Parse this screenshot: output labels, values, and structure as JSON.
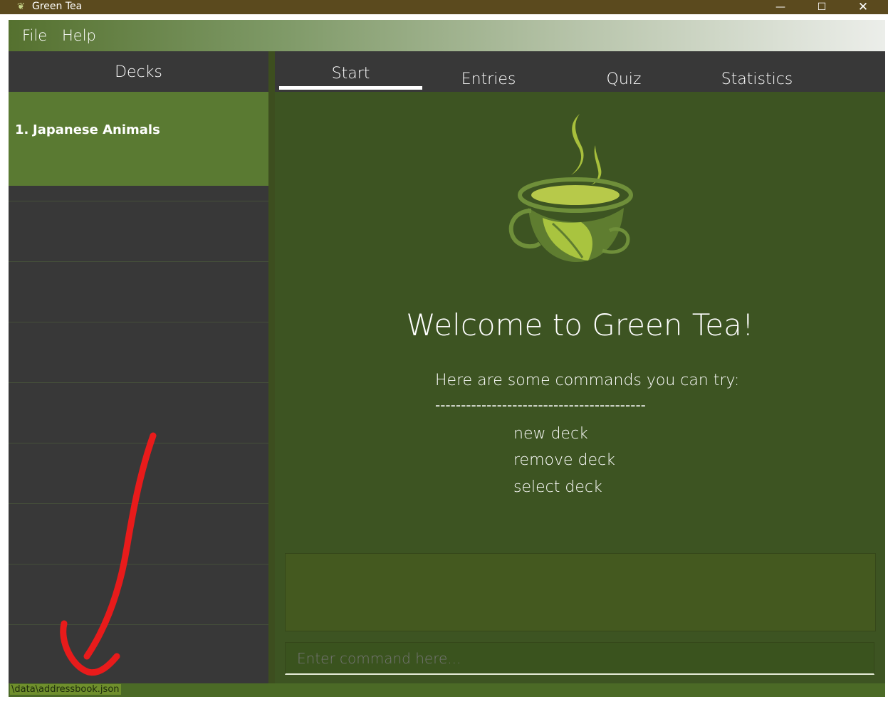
{
  "window": {
    "title": "Green Tea",
    "app_icon": "tea-leaf-icon",
    "controls": {
      "minimize": "—",
      "maximize": "☐",
      "close": "✕"
    }
  },
  "menu": {
    "file": "File",
    "help": "Help"
  },
  "sidebar": {
    "header": "Decks",
    "decks": [
      {
        "index": "1.",
        "name": "Japanese Animals"
      }
    ]
  },
  "tabs": [
    {
      "label": "Start",
      "active": true
    },
    {
      "label": "Entries",
      "active": false
    },
    {
      "label": "Quiz",
      "active": false
    },
    {
      "label": "Statistics",
      "active": false
    }
  ],
  "welcome": {
    "title": "Welcome to Green Tea!",
    "hint": "Here are some commands you can try:",
    "divider": "-----------------------------------------",
    "commands": [
      "new deck",
      "remove deck",
      "select deck"
    ]
  },
  "command_input": {
    "placeholder": "Enter command here..."
  },
  "status": {
    "path": "\\data\\addressbook.json"
  },
  "colors": {
    "title_bar": "#5b4a1e",
    "sidebar_bg": "#383838",
    "selected_deck": "#5a7a32",
    "main_bg": "#3d5422",
    "annotation_arrow": "#e81b1b"
  }
}
